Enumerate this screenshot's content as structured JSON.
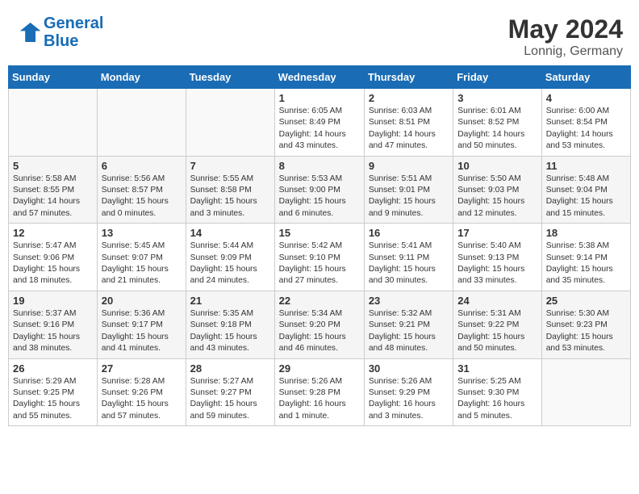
{
  "header": {
    "logo_line1": "General",
    "logo_line2": "Blue",
    "month": "May 2024",
    "location": "Lonnig, Germany"
  },
  "days_of_week": [
    "Sunday",
    "Monday",
    "Tuesday",
    "Wednesday",
    "Thursday",
    "Friday",
    "Saturday"
  ],
  "weeks": [
    [
      {
        "day": "",
        "info": ""
      },
      {
        "day": "",
        "info": ""
      },
      {
        "day": "",
        "info": ""
      },
      {
        "day": "1",
        "info": "Sunrise: 6:05 AM\nSunset: 8:49 PM\nDaylight: 14 hours\nand 43 minutes."
      },
      {
        "day": "2",
        "info": "Sunrise: 6:03 AM\nSunset: 8:51 PM\nDaylight: 14 hours\nand 47 minutes."
      },
      {
        "day": "3",
        "info": "Sunrise: 6:01 AM\nSunset: 8:52 PM\nDaylight: 14 hours\nand 50 minutes."
      },
      {
        "day": "4",
        "info": "Sunrise: 6:00 AM\nSunset: 8:54 PM\nDaylight: 14 hours\nand 53 minutes."
      }
    ],
    [
      {
        "day": "5",
        "info": "Sunrise: 5:58 AM\nSunset: 8:55 PM\nDaylight: 14 hours\nand 57 minutes."
      },
      {
        "day": "6",
        "info": "Sunrise: 5:56 AM\nSunset: 8:57 PM\nDaylight: 15 hours\nand 0 minutes."
      },
      {
        "day": "7",
        "info": "Sunrise: 5:55 AM\nSunset: 8:58 PM\nDaylight: 15 hours\nand 3 minutes."
      },
      {
        "day": "8",
        "info": "Sunrise: 5:53 AM\nSunset: 9:00 PM\nDaylight: 15 hours\nand 6 minutes."
      },
      {
        "day": "9",
        "info": "Sunrise: 5:51 AM\nSunset: 9:01 PM\nDaylight: 15 hours\nand 9 minutes."
      },
      {
        "day": "10",
        "info": "Sunrise: 5:50 AM\nSunset: 9:03 PM\nDaylight: 15 hours\nand 12 minutes."
      },
      {
        "day": "11",
        "info": "Sunrise: 5:48 AM\nSunset: 9:04 PM\nDaylight: 15 hours\nand 15 minutes."
      }
    ],
    [
      {
        "day": "12",
        "info": "Sunrise: 5:47 AM\nSunset: 9:06 PM\nDaylight: 15 hours\nand 18 minutes."
      },
      {
        "day": "13",
        "info": "Sunrise: 5:45 AM\nSunset: 9:07 PM\nDaylight: 15 hours\nand 21 minutes."
      },
      {
        "day": "14",
        "info": "Sunrise: 5:44 AM\nSunset: 9:09 PM\nDaylight: 15 hours\nand 24 minutes."
      },
      {
        "day": "15",
        "info": "Sunrise: 5:42 AM\nSunset: 9:10 PM\nDaylight: 15 hours\nand 27 minutes."
      },
      {
        "day": "16",
        "info": "Sunrise: 5:41 AM\nSunset: 9:11 PM\nDaylight: 15 hours\nand 30 minutes."
      },
      {
        "day": "17",
        "info": "Sunrise: 5:40 AM\nSunset: 9:13 PM\nDaylight: 15 hours\nand 33 minutes."
      },
      {
        "day": "18",
        "info": "Sunrise: 5:38 AM\nSunset: 9:14 PM\nDaylight: 15 hours\nand 35 minutes."
      }
    ],
    [
      {
        "day": "19",
        "info": "Sunrise: 5:37 AM\nSunset: 9:16 PM\nDaylight: 15 hours\nand 38 minutes."
      },
      {
        "day": "20",
        "info": "Sunrise: 5:36 AM\nSunset: 9:17 PM\nDaylight: 15 hours\nand 41 minutes."
      },
      {
        "day": "21",
        "info": "Sunrise: 5:35 AM\nSunset: 9:18 PM\nDaylight: 15 hours\nand 43 minutes."
      },
      {
        "day": "22",
        "info": "Sunrise: 5:34 AM\nSunset: 9:20 PM\nDaylight: 15 hours\nand 46 minutes."
      },
      {
        "day": "23",
        "info": "Sunrise: 5:32 AM\nSunset: 9:21 PM\nDaylight: 15 hours\nand 48 minutes."
      },
      {
        "day": "24",
        "info": "Sunrise: 5:31 AM\nSunset: 9:22 PM\nDaylight: 15 hours\nand 50 minutes."
      },
      {
        "day": "25",
        "info": "Sunrise: 5:30 AM\nSunset: 9:23 PM\nDaylight: 15 hours\nand 53 minutes."
      }
    ],
    [
      {
        "day": "26",
        "info": "Sunrise: 5:29 AM\nSunset: 9:25 PM\nDaylight: 15 hours\nand 55 minutes."
      },
      {
        "day": "27",
        "info": "Sunrise: 5:28 AM\nSunset: 9:26 PM\nDaylight: 15 hours\nand 57 minutes."
      },
      {
        "day": "28",
        "info": "Sunrise: 5:27 AM\nSunset: 9:27 PM\nDaylight: 15 hours\nand 59 minutes."
      },
      {
        "day": "29",
        "info": "Sunrise: 5:26 AM\nSunset: 9:28 PM\nDaylight: 16 hours\nand 1 minute."
      },
      {
        "day": "30",
        "info": "Sunrise: 5:26 AM\nSunset: 9:29 PM\nDaylight: 16 hours\nand 3 minutes."
      },
      {
        "day": "31",
        "info": "Sunrise: 5:25 AM\nSunset: 9:30 PM\nDaylight: 16 hours\nand 5 minutes."
      },
      {
        "day": "",
        "info": ""
      }
    ]
  ]
}
